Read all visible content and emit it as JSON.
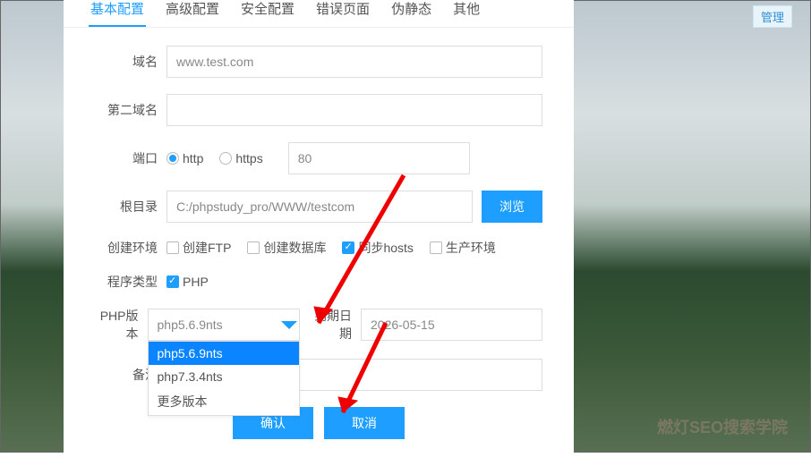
{
  "bg_tag": "管理",
  "watermark": "燃灯SEO搜索学院",
  "tabs": [
    "基本配置",
    "高级配置",
    "安全配置",
    "错误页面",
    "伪静态",
    "其他"
  ],
  "active_tab": 0,
  "labels": {
    "domain": "域名",
    "second_domain": "第二域名",
    "port": "端口",
    "root": "根目录",
    "env": "创建环境",
    "program": "程序类型",
    "php_version": "PHP版本",
    "expire": "到期日期",
    "note": "备注"
  },
  "values": {
    "domain": "www.test.com",
    "second_domain": "",
    "port": "80",
    "root": "C:/phpstudy_pro/WWW/testcom",
    "php_version": "php5.6.9nts",
    "expire": "2026-05-15",
    "note": ""
  },
  "port_options": {
    "http": "http",
    "https": "https",
    "selected": "http"
  },
  "env_options": {
    "ftp": "创建FTP",
    "db": "创建数据库",
    "hosts": "同步hosts",
    "prod": "生产环境",
    "hosts_checked": true
  },
  "program_option": {
    "label": "PHP",
    "checked": true
  },
  "dropdown": {
    "items": [
      "php5.6.9nts",
      "php7.3.4nts",
      "更多版本"
    ],
    "selected": 0
  },
  "buttons": {
    "browse": "浏览",
    "confirm": "确认",
    "cancel": "取消"
  }
}
